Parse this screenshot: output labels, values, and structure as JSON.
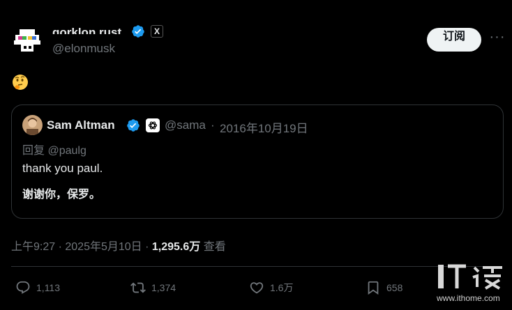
{
  "post": {
    "display_name": "gorklon rust",
    "handle": "@elonmusk",
    "x_badge": "X",
    "subscribe_label": "订阅",
    "more_label": "···",
    "body_emoji": "thinking-face-emoji"
  },
  "quoted": {
    "name": "Sam Altman",
    "handle": "@sama",
    "separator": "·",
    "date": "2016年10月19日",
    "reply_to": "回复 @paulg",
    "text": "thank you paul.",
    "translation": "谢谢你，保罗。"
  },
  "meta": {
    "time": "上午9:27",
    "dot1": " · ",
    "date": "2025年5月10日",
    "dot2": " · ",
    "views_count": "1,295.6万",
    "views_label": " 查看"
  },
  "actions": {
    "replies": "1,113",
    "retweets": "1,374",
    "likes": "1.6万",
    "bookmarks": "658"
  },
  "watermark": {
    "brand": "IT之家",
    "url": "www.ithome.com"
  },
  "colors": {
    "background": "#000000",
    "text": "#e7e9ea",
    "muted": "#71767b",
    "verified": "#1d9bf0",
    "border": "#2f3336"
  }
}
